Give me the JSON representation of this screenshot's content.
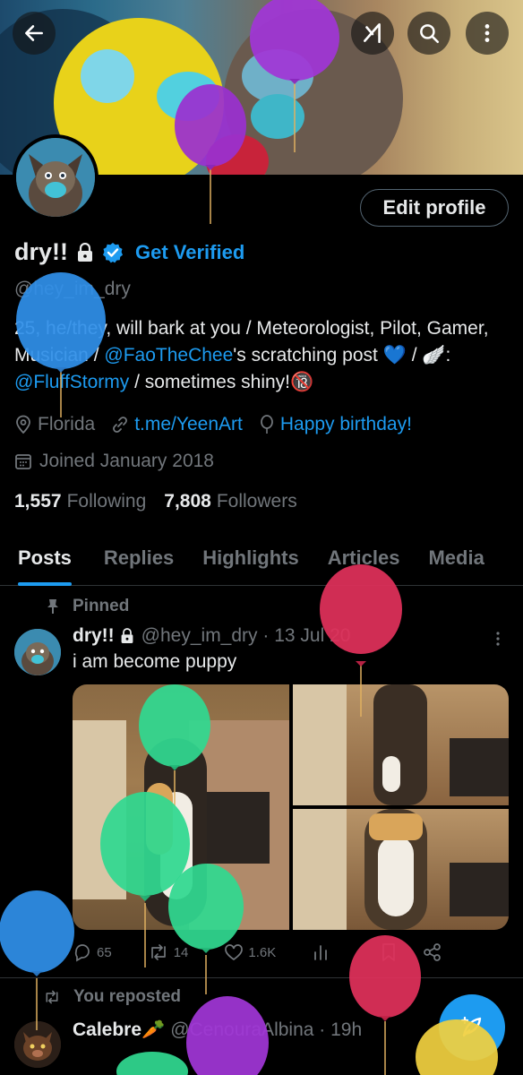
{
  "header": {
    "back_icon": "arrow-left-icon",
    "grok_icon": "grok-icon",
    "search_icon": "search-icon",
    "more_icon": "more-vertical-icon"
  },
  "profile": {
    "edit_button": "Edit profile",
    "name": "dry!!",
    "get_verified": "Get Verified",
    "handle": "@hey_im_dry",
    "bio_1": "25, he/they, will bark at you / Meteorologist, Pilot, Gamer, Musician / ",
    "bio_mention_1": "@FaoTheChee",
    "bio_2": "'s scratching post",
    "bio_3": "💙 / 🪽: ",
    "bio_mention_2": "@FluffStormy",
    "bio_4": " / sometimes shiny!🔞",
    "location": "Florida",
    "link": "t.me/YeenArt",
    "birthday": "Happy birthday!",
    "joined": "Joined January 2018",
    "following_count": "1,557",
    "following_label": "Following",
    "followers_count": "7,808",
    "followers_label": "Followers"
  },
  "tabs": [
    "Posts",
    "Replies",
    "Highlights",
    "Articles",
    "Media"
  ],
  "post": {
    "pinned_label": "Pinned",
    "author": "dry!!",
    "handle_date": "@hey_im_dry · 13 Jul 20",
    "text": "i am become puppy",
    "replies": "65",
    "reposts": "14",
    "likes": "1.6K"
  },
  "post2": {
    "reposted_label": "You reposted",
    "author": "Calebre🥕",
    "handle_date": "@CenouraAlbina · 19h"
  },
  "colors": {
    "accent": "#1d9bf0",
    "muted": "#71767b",
    "text": "#e7e9ea"
  }
}
